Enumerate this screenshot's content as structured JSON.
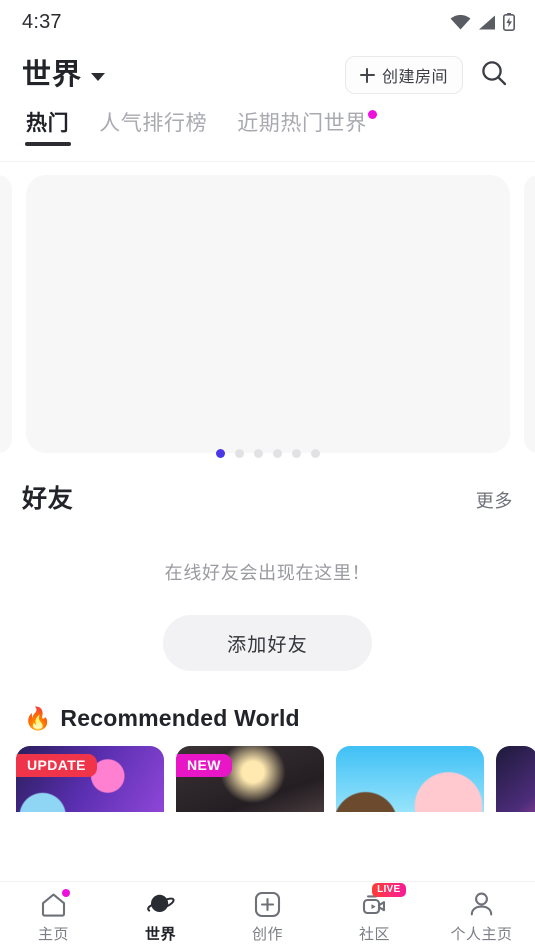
{
  "status_bar": {
    "time": "4:37",
    "icons": [
      "wifi-icon",
      "cellular-signal-icon",
      "battery-charging-icon"
    ]
  },
  "header": {
    "title": "世界",
    "dropdown_icon": "chevron-down-icon",
    "create_room_label": "创建房间",
    "create_room_icon": "plus-icon",
    "search_icon": "search-icon"
  },
  "tabs": [
    {
      "label": "热门",
      "active": true,
      "badge": false
    },
    {
      "label": "人气排行榜",
      "active": false,
      "badge": false
    },
    {
      "label": "近期热门世界",
      "active": false,
      "badge": true
    }
  ],
  "carousel": {
    "slide_count": 6,
    "active_index": 0,
    "state": "empty-placeholder"
  },
  "friends": {
    "title": "好友",
    "more_label": "更多",
    "empty_text": "在线好友会出现在这里！",
    "add_friend_label": "添加好友"
  },
  "recommended": {
    "fire_icon": "🔥",
    "title": "Recommended World",
    "cards": [
      {
        "badge": "UPDATE",
        "badge_color": "#F0354B",
        "theme": "c1"
      },
      {
        "badge": "NEW",
        "badge_color": "#E916C7",
        "theme": "c2"
      },
      {
        "badge": "",
        "badge_color": "",
        "theme": "c3"
      },
      {
        "badge": "",
        "badge_color": "",
        "theme": "c4"
      }
    ]
  },
  "bottom_nav": [
    {
      "label": "主页",
      "icon": "home-icon",
      "active": false,
      "badge_dot": true,
      "live_badge": ""
    },
    {
      "label": "世界",
      "icon": "planet-icon",
      "active": true,
      "badge_dot": false,
      "live_badge": ""
    },
    {
      "label": "创作",
      "icon": "plus-square-icon",
      "active": false,
      "badge_dot": false,
      "live_badge": ""
    },
    {
      "label": "社区",
      "icon": "video-camera-icon",
      "active": false,
      "badge_dot": false,
      "live_badge": "LIVE"
    },
    {
      "label": "个人主页",
      "icon": "person-icon",
      "active": false,
      "badge_dot": false,
      "live_badge": ""
    }
  ],
  "colors": {
    "accent_magenta": "#EE10DD",
    "accent_blue": "#4A38E8",
    "text_primary": "#22242A",
    "text_muted": "#9A9BA1",
    "placeholder_bg": "#F7F7F8"
  }
}
